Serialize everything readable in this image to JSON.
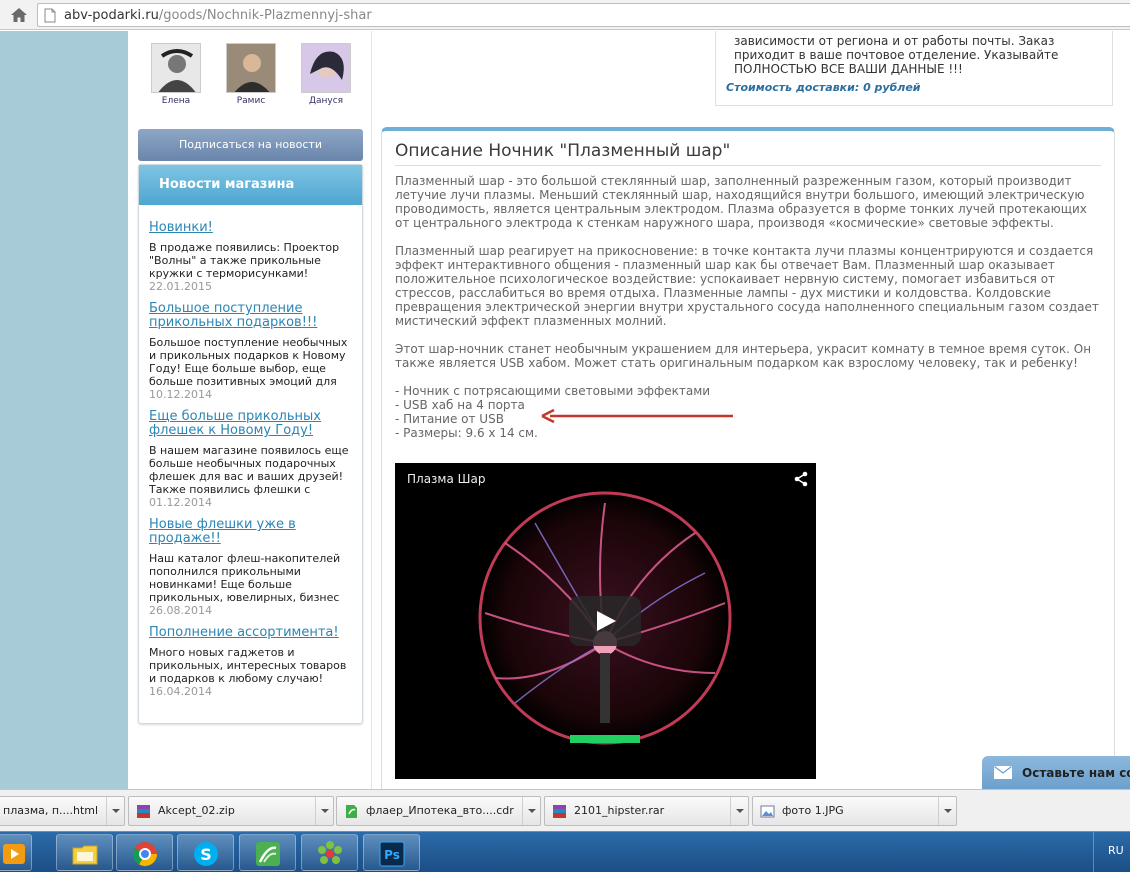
{
  "browser": {
    "url_host": "abv-podarki.ru",
    "url_path": "/goods/Nochnik-Plazmennyj-shar"
  },
  "people": [
    {
      "name": "Елена"
    },
    {
      "name": "Рамис"
    },
    {
      "name": "Дануся"
    }
  ],
  "sidebar": {
    "subscribe_label": "Подписаться на новости",
    "news_heading": "Новости магазина",
    "news": [
      {
        "title": "Новинки!",
        "text": "В продаже появились: Проектор \"Волны\" а также прикольные кружки с терморисунками!",
        "date": "22.01.2015"
      },
      {
        "title": "Большое поступление прикольных подарков!!!",
        "text": "Большое поступление необычных и прикольных подарков к Новому Году! Еще больше выбор, еще больше позитивных эмоций для",
        "date": "10.12.2014"
      },
      {
        "title": "Еще больше прикольных флешек к Новому Году!",
        "text": "В нашем магазине появилось еще больше необычных подарочных флешек для вас и ваших друзей! Также появились флешки с",
        "date": "01.12.2014"
      },
      {
        "title": "Новые флешки уже в продаже!!",
        "text": "Наш каталог флеш-накопителей пополнился прикольными новинками! Еще больше прикольных, ювелирных, бизнес",
        "date": "26.08.2014"
      },
      {
        "title": "Пополнение ассортимента!",
        "text": "Много новых гаджетов и прикольных, интересных товаров и подарков к любому случаю!",
        "date": "16.04.2014"
      }
    ]
  },
  "delivery": {
    "text": "зависимости от региона и от работы почты. Заказ приходит в ваше почтовое отделение. Указывайте ПОЛНОСТЬЮ ВСЕ ВАШИ ДАННЫЕ !!!",
    "cost": "Стоимость доставки: 0 рублей"
  },
  "description": {
    "title": "Описание Ночник \"Плазменный шар\"",
    "p1": "Плазменный шар - это большой стеклянный шар, заполненный разреженным газом, который производит летучие лучи плазмы. Меньший стеклянный шар, находящийся внутри большого, имеющий электрическую проводимость, является центральным электродом. Плазма образуется в форме тонких лучей протекающих от центрального электрода к стенкам наружного шара, производя «космические» световые эффекты.",
    "p2": "Плазменный шар реагирует на прикосновение: в точке контакта лучи плазмы концентрируются и создается эффект интерактивного общения - плазменный шар как бы отвечает Вам. Плазменный шар оказывает положительное психологическое воздействие: успокаивает нервную систему, помогает избавиться от стрессов, расслабиться во время отдыха. Плазменные лампы - дух мистики и колдовства. Колдовские превращения электрической энергии внутри хрустального сосуда наполненного специальным газом создает мистический эффект плазменных молний.",
    "p3": "Этот шар-ночник станет необычным украшением для интерьера, украсит комнату в темное время суток. Он также является USB хабом. Может стать оригинальным подарком как взрослому человеку, так и ребенку!",
    "features": [
      "- Ночник с потрясающими световыми эффектами",
      "- USB хаб на 4 порта",
      "- Питание от USB",
      "- Размеры: 9.6 х 14 см."
    ]
  },
  "video": {
    "title": "Плазма Шар"
  },
  "feedback_label": "Оставьте нам со",
  "downloads": [
    {
      "name": "плазма, п....html"
    },
    {
      "name": "Akcept_02.zip"
    },
    {
      "name": "флаер_Ипотека_вто....cdr"
    },
    {
      "name": "2101_hipster.rar"
    },
    {
      "name": "фото 1.JPG"
    }
  ],
  "taskbar": {
    "lang": "RU"
  },
  "colors": {
    "accent": "#2b86b4",
    "arrow": "#c0392b",
    "news_header": "#4ea6d0"
  }
}
